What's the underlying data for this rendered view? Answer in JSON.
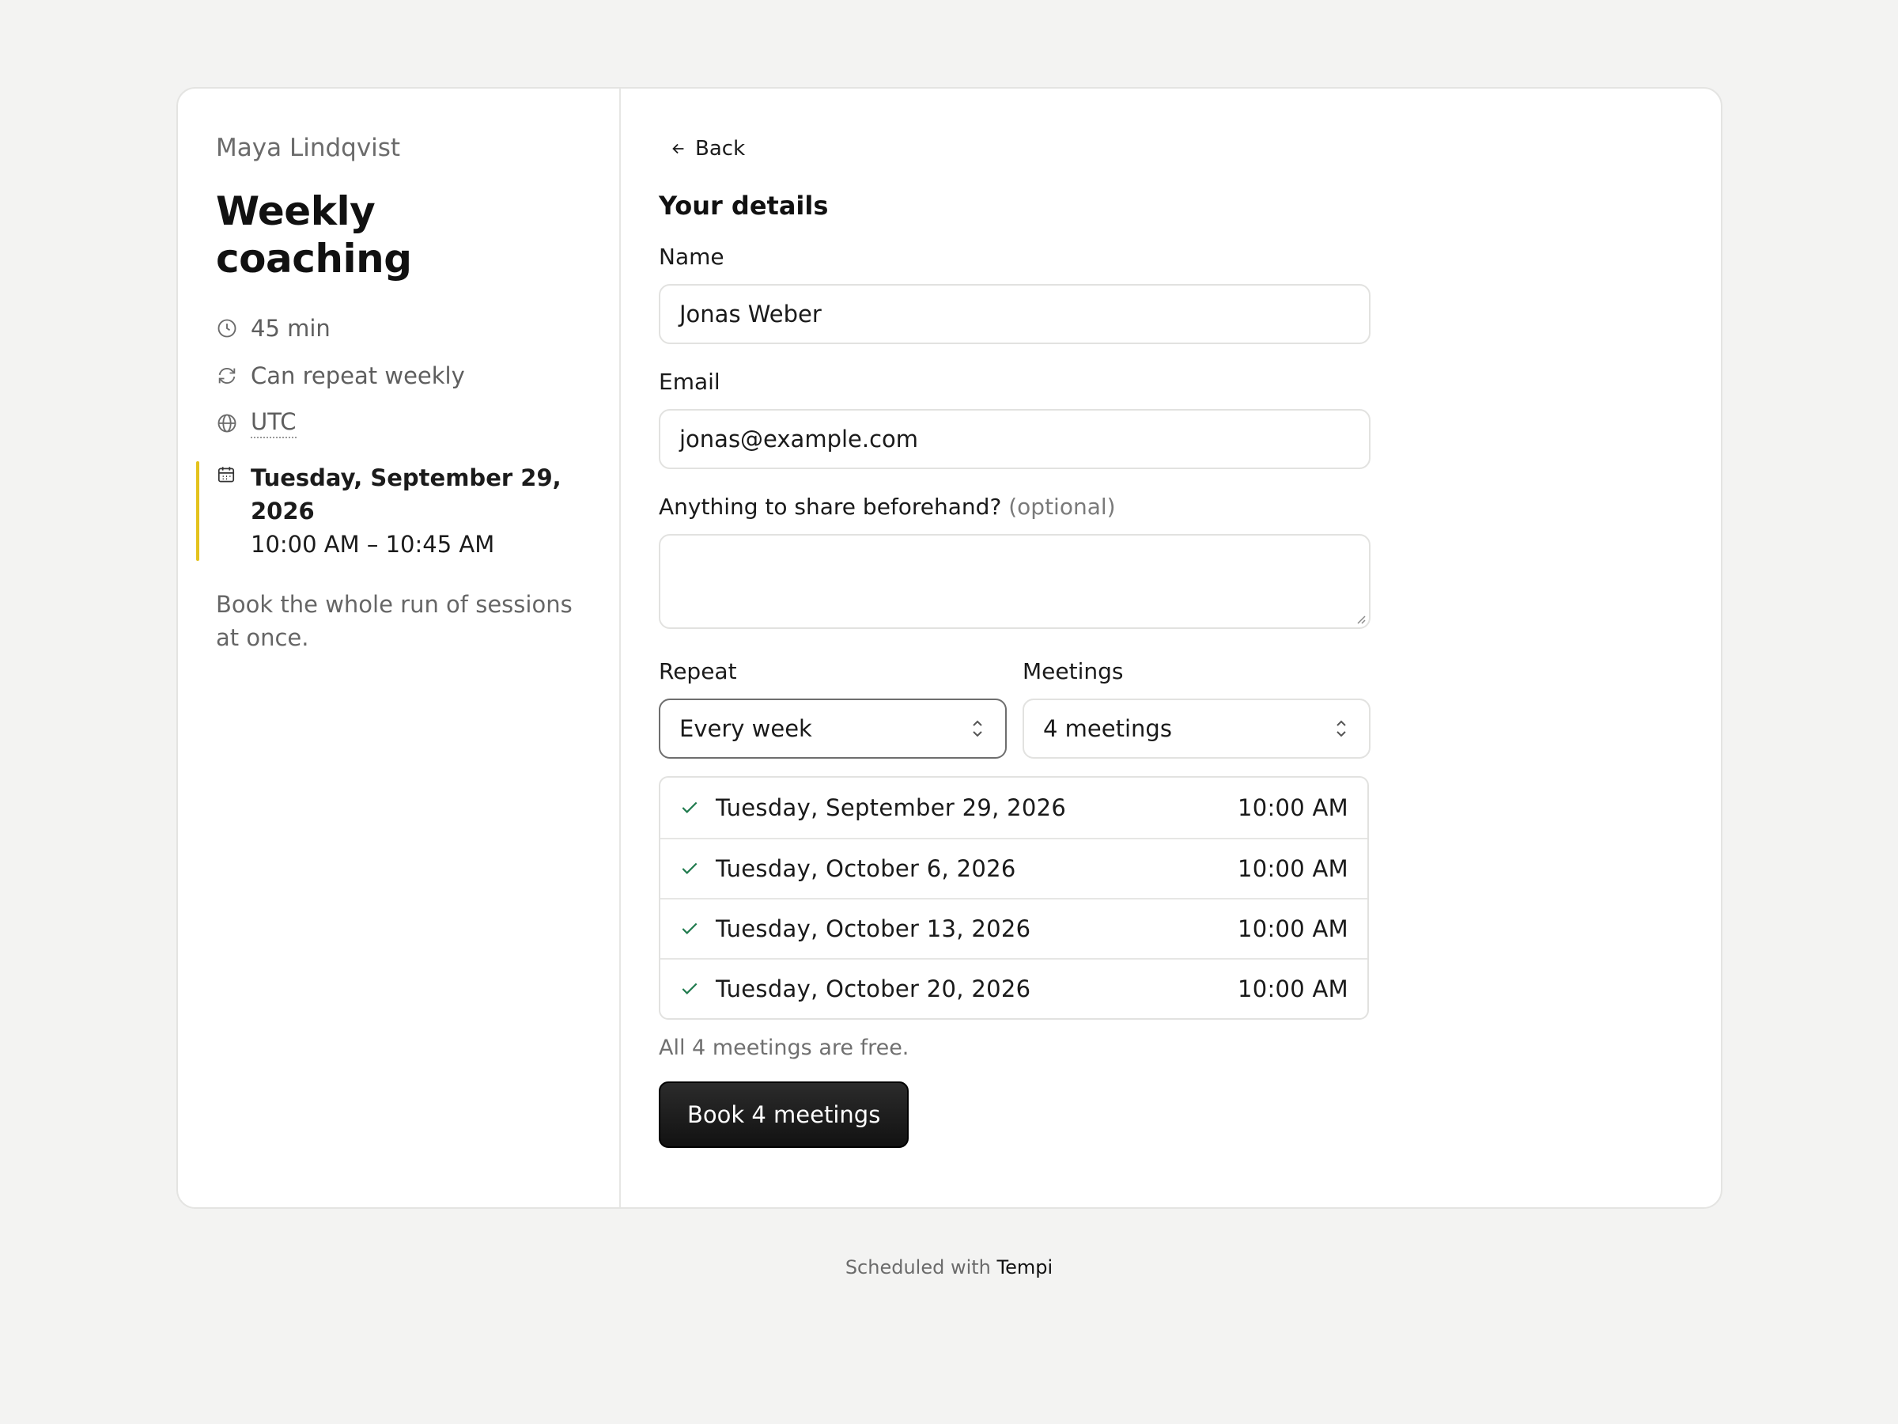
{
  "event": {
    "host": "Maya Lindqvist",
    "title": "Weekly coaching",
    "duration": "45 min",
    "repeat_info": "Can repeat weekly",
    "timezone": "UTC",
    "selected_date": "Tuesday, September 29, 2026",
    "selected_time": "10:00 AM – 10:45 AM",
    "description": "Book the whole run of sessions at once.",
    "accent_color": "#e4c21c"
  },
  "form": {
    "back_label": "Back",
    "section_title": "Your details",
    "name_label": "Name",
    "name_value": "Jonas Weber",
    "email_label": "Email",
    "email_value": "jonas@example.com",
    "notes_label": "Anything to share beforehand?",
    "notes_optional": "(optional)",
    "notes_value": "",
    "repeat_label": "Repeat",
    "repeat_value": "Every week",
    "meetings_label": "Meetings",
    "meetings_value": "4 meetings"
  },
  "occurrences": [
    {
      "date": "Tuesday, September 29, 2026",
      "time": "10:00 AM"
    },
    {
      "date": "Tuesday, October 6, 2026",
      "time": "10:00 AM"
    },
    {
      "date": "Tuesday, October 13, 2026",
      "time": "10:00 AM"
    },
    {
      "date": "Tuesday, October 20, 2026",
      "time": "10:00 AM"
    }
  ],
  "summary_note": "All 4 meetings are free.",
  "book_button": "Book 4 meetings",
  "footer": {
    "prefix": "Scheduled with",
    "brand": "Tempi"
  },
  "colors": {
    "check": "#1f7a4d",
    "button_bg": "#1a1a1a"
  }
}
